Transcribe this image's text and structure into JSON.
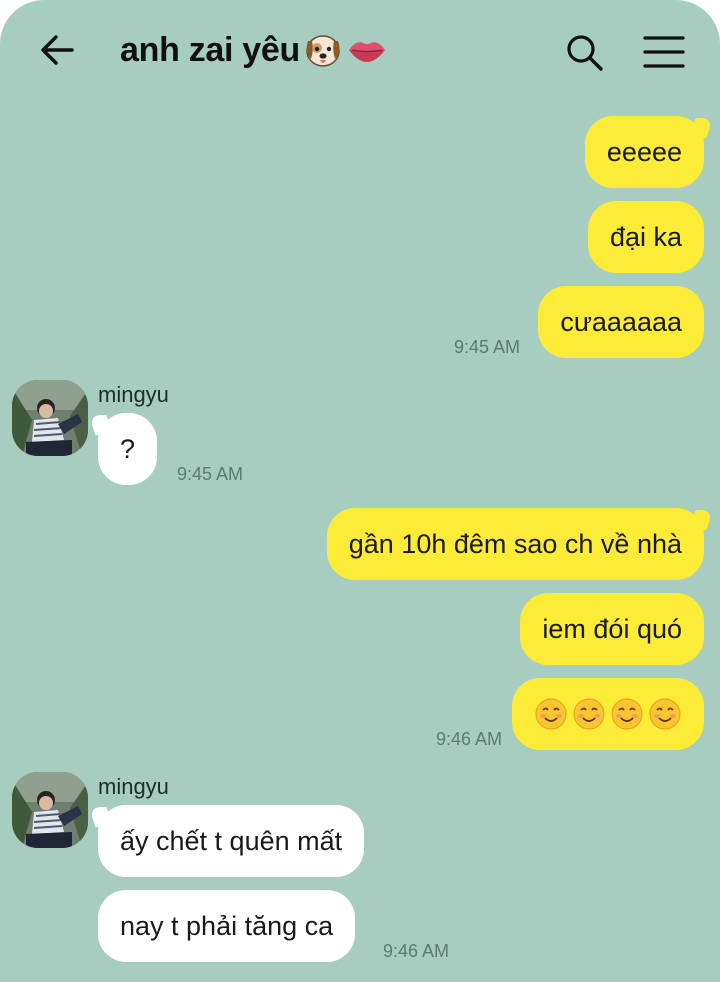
{
  "header": {
    "title": "anh zai yêu",
    "title_emojis": [
      "dog-face",
      "lips"
    ]
  },
  "messages": [
    {
      "id": "m1",
      "side": "me",
      "text": "eeeee"
    },
    {
      "id": "m2",
      "side": "me",
      "text": "đại ka"
    },
    {
      "id": "m3",
      "side": "me",
      "text": "cưaaaaaa",
      "time": "9:45 AM"
    },
    {
      "id": "m4",
      "side": "them",
      "sender": "mingyu",
      "text": "?",
      "time": "9:45 AM"
    },
    {
      "id": "m5",
      "side": "me",
      "text": "gần 10h đêm sao ch về nhà"
    },
    {
      "id": "m6",
      "side": "me",
      "text": "iem đói quó"
    },
    {
      "id": "m7",
      "side": "me",
      "text": "☺️☺️☺️☺️",
      "emoji_count": 4,
      "emoji": "smiling-face",
      "time": "9:46 AM"
    },
    {
      "id": "m8",
      "side": "them",
      "sender": "mingyu",
      "text": "ấy chết t quên mất"
    },
    {
      "id": "m9",
      "side": "them",
      "text": "nay t phải tăng ca",
      "time": "9:46 AM"
    }
  ],
  "colors": {
    "background": "#a6cdbf",
    "my_bubble": "#fceb37",
    "their_bubble": "#ffffff",
    "timestamp": "#5d7a72"
  },
  "icons": {
    "back": "arrow-left-icon",
    "search": "search-icon",
    "menu": "hamburger-menu-icon"
  }
}
